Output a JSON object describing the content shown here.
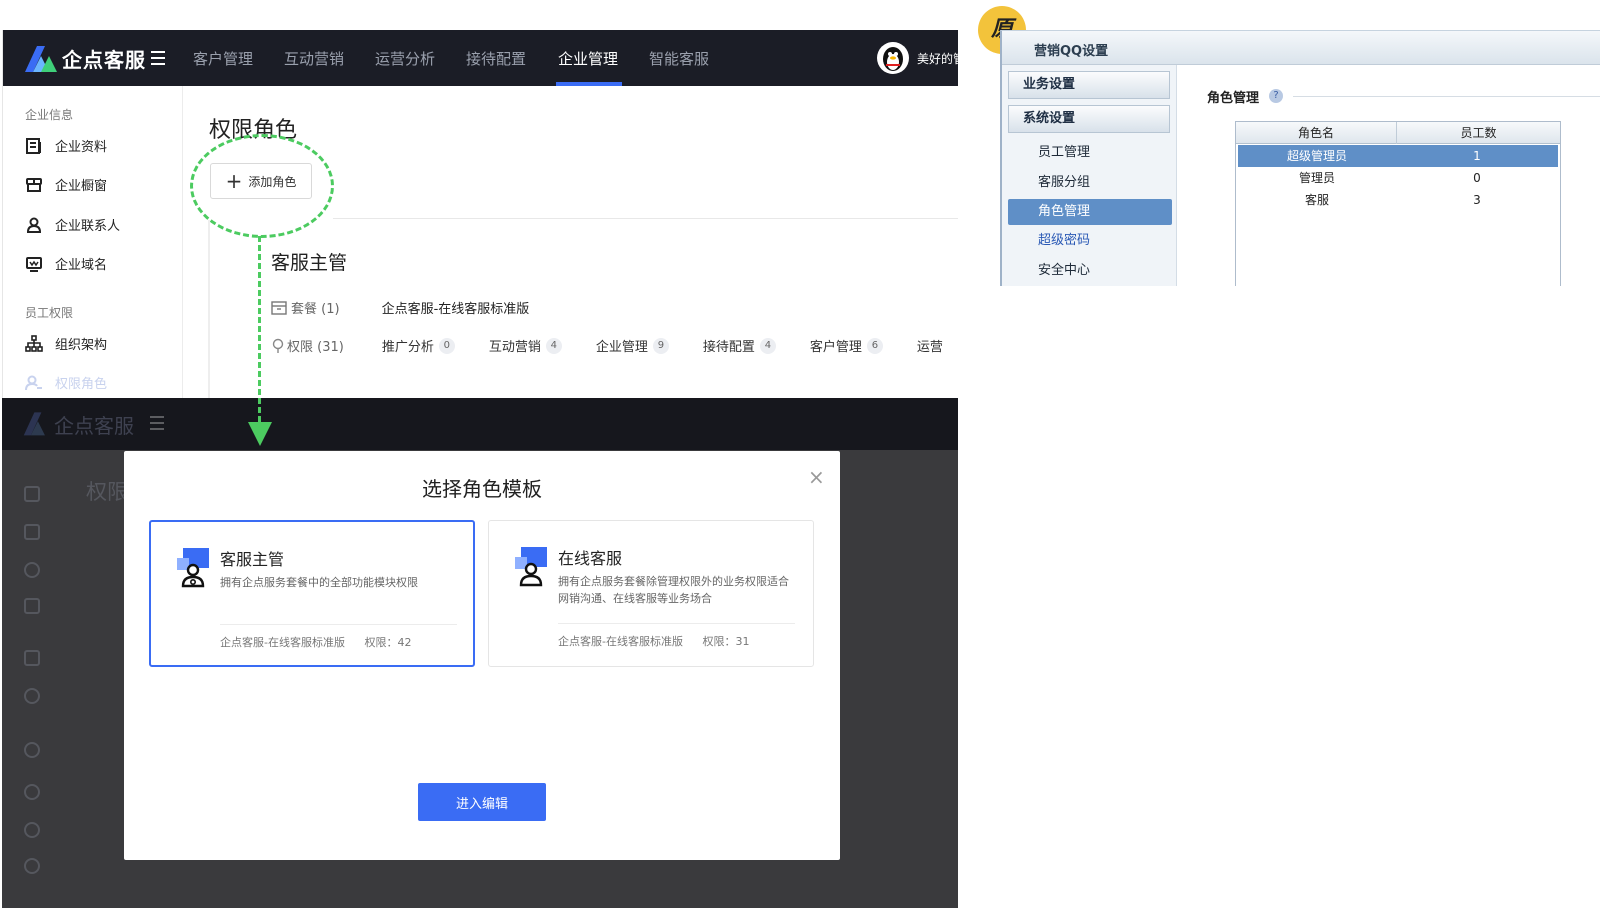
{
  "app": {
    "logo_text": "企点客服",
    "nav": [
      "客户管理",
      "互动营销",
      "运营分析",
      "接待配置",
      "企业管理",
      "智能客服"
    ],
    "active_nav": "企业管理",
    "user_name": "美好的管理员账号"
  },
  "sidebar": {
    "group1": "企业信息",
    "items1": [
      {
        "label": "企业资料",
        "icon": "document-icon"
      },
      {
        "label": "企业橱窗",
        "icon": "shop-icon"
      },
      {
        "label": "企业联系人",
        "icon": "contact-icon"
      },
      {
        "label": "企业域名",
        "icon": "domain-icon"
      }
    ],
    "group2": "员工权限",
    "items2": [
      {
        "label": "组织架构",
        "icon": "org-chart-icon"
      },
      {
        "label": "权限角色",
        "icon": "role-icon"
      }
    ]
  },
  "main": {
    "title": "权限角色",
    "add_button": "添加角色",
    "role_name": "客服主管",
    "package_label": "套餐 (1)",
    "package_value": "企点客服-在线客服标准版",
    "permission_label": "权限 (31)",
    "permissions": [
      {
        "name": "推广分析",
        "count": "0"
      },
      {
        "name": "互动营销",
        "count": "4"
      },
      {
        "name": "企业管理",
        "count": "9"
      },
      {
        "name": "接待配置",
        "count": "4"
      },
      {
        "name": "客户管理",
        "count": "6"
      },
      {
        "name": "运营",
        "count": ""
      }
    ]
  },
  "modal": {
    "title": "选择角色模板",
    "close": "×",
    "templates": [
      {
        "name": "客服主管",
        "desc": "拥有企点服务套餐中的全部功能模块权限",
        "package": "企点客服-在线客服标准版",
        "perm": "权限：42"
      },
      {
        "name": "在线客服",
        "desc": "拥有企点服务套餐除管理权限外的业务权限适合网销沟通、在线客服等业务场合",
        "package": "企点客服-在线客服标准版",
        "perm": "权限：31"
      }
    ],
    "enter_button": "进入编辑"
  },
  "legacy": {
    "badge": "原",
    "title": "营销QQ设置",
    "groups": [
      "业务设置",
      "系统设置"
    ],
    "subs": [
      "员工管理",
      "客服分组",
      "角色管理",
      "超级密码",
      "安全中心"
    ],
    "active_sub": "角色管理",
    "heading": "角色管理",
    "help": "?",
    "columns": [
      "角色名",
      "员工数"
    ],
    "rows": [
      {
        "name": "超级管理员",
        "count": "1"
      },
      {
        "name": "管理员",
        "count": "0"
      },
      {
        "name": "客服",
        "count": "3"
      }
    ]
  },
  "colors": {
    "accent": "#3a6cf4",
    "nav_bg": "#1b1d26",
    "annotation_green": "#4ccb60",
    "badge_yellow": "#f3c33b"
  }
}
